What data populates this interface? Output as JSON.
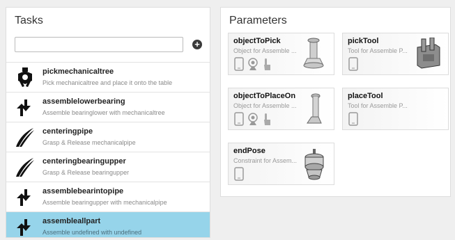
{
  "tasks_panel": {
    "title": "Tasks",
    "search_value": "",
    "add_button": "+",
    "items": [
      {
        "name": "pickmechanicaltree",
        "desc": "Pick mechanicaltree and place it onto the table",
        "icon": "gripper-icon"
      },
      {
        "name": "assemblelowerbearing",
        "desc": "Assemble bearinglower with mechanicaltree",
        "icon": "assemble-arrows-icon"
      },
      {
        "name": "centeringpipe",
        "desc": "Grasp & Release mechanicalpipe",
        "icon": "tweezers-icon"
      },
      {
        "name": "centeringbearingupper",
        "desc": "Grasp & Release bearingupper",
        "icon": "tweezers-icon"
      },
      {
        "name": "assemblebearintopipe",
        "desc": "Assemble bearingupper with mechanicalpipe",
        "icon": "assemble-arrows-icon"
      },
      {
        "name": "assembleallpart",
        "desc": "Assemble undefined with undefined",
        "icon": "assemble-arrows-icon",
        "selected": true
      }
    ]
  },
  "params_panel": {
    "title": "Parameters",
    "cards": [
      {
        "name": "objectToPick",
        "desc": "Object for Assemble ...",
        "icons": [
          "tablet-icon",
          "webcam-icon",
          "hand-icon"
        ],
        "picture": "mechanical-tree-image"
      },
      {
        "name": "pickTool",
        "desc": "Tool for Assemble P...",
        "icons": [
          "tablet-icon"
        ],
        "picture": "gripper-tool-image"
      },
      {
        "name": "objectToPlaceOn",
        "desc": "Object for Assemble ...",
        "icons": [
          "tablet-icon",
          "webcam-icon",
          "hand-icon"
        ],
        "picture": "pipe-image"
      },
      {
        "name": "placeTool",
        "desc": "Tool for Assemble P...",
        "icons": [
          "tablet-icon"
        ],
        "picture": ""
      },
      {
        "name": "endPose",
        "desc": "Constraint for Assem...",
        "icons": [
          "tablet-icon"
        ],
        "picture": "bearing-assembly-image"
      }
    ]
  }
}
